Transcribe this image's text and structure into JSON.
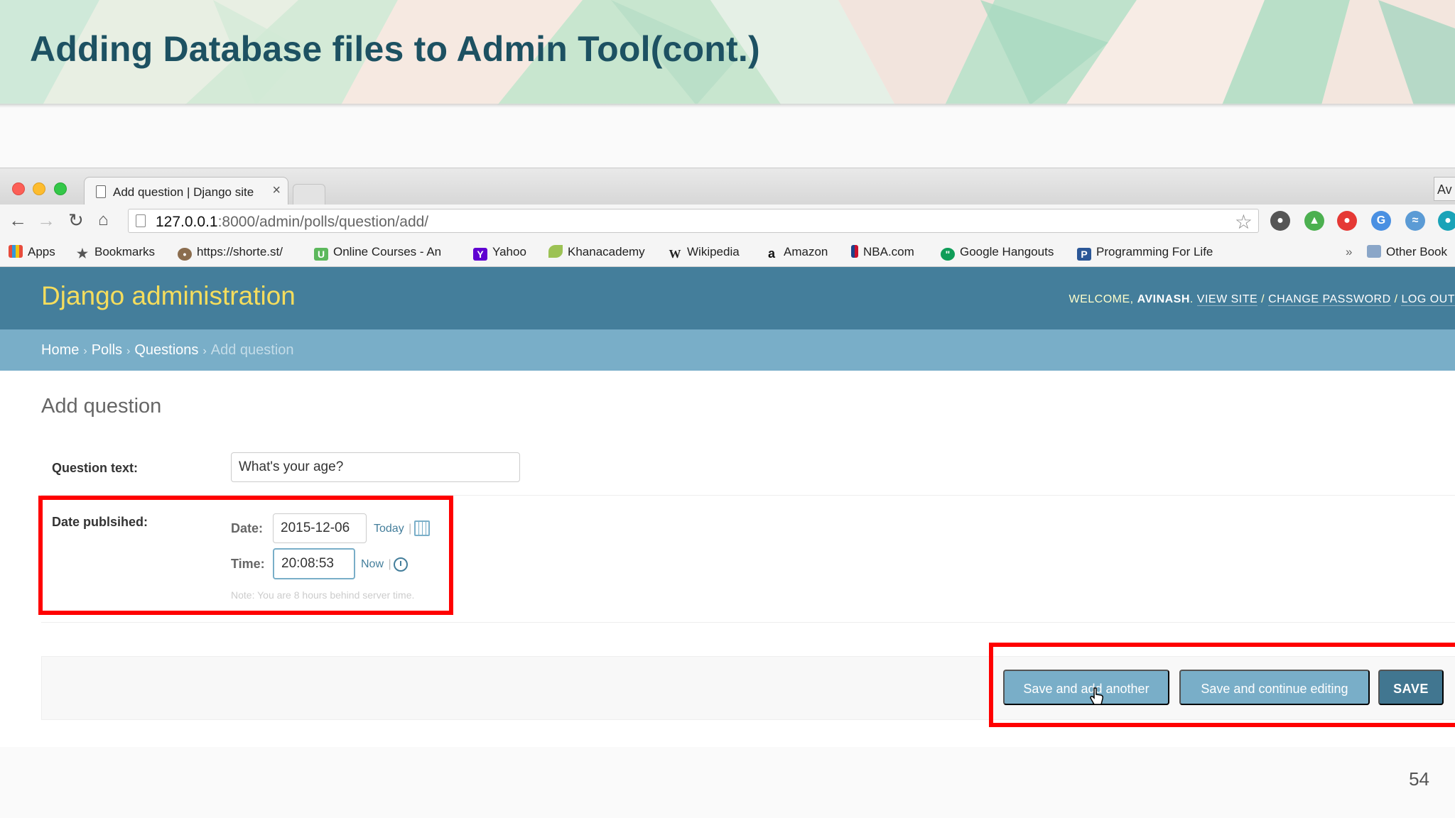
{
  "slide": {
    "title": "Adding Database files to Admin Tool(cont.)",
    "page_number": "54"
  },
  "browser": {
    "tab_title": "Add question | Django site",
    "tab_close": "×",
    "profile_label": "Av",
    "url_host": "127.0.0.1",
    "url_rest": ":8000/admin/polls/question/add/",
    "bookmarks": [
      {
        "label": "Apps",
        "icon": "apps-grid-icon"
      },
      {
        "label": "Bookmarks",
        "icon": "star-icon"
      },
      {
        "label": "https://shorte.st/",
        "icon": "shortest-icon"
      },
      {
        "label": "Online Courses - An",
        "icon": "udemy-icon"
      },
      {
        "label": "Yahoo",
        "icon": "yahoo-icon"
      },
      {
        "label": "Khanacademy",
        "icon": "leaf-icon"
      },
      {
        "label": "Wikipedia",
        "icon": "wikipedia-icon"
      },
      {
        "label": "Amazon",
        "icon": "amazon-icon"
      },
      {
        "label": "NBA.com",
        "icon": "nba-icon"
      },
      {
        "label": "Google Hangouts",
        "icon": "hangouts-icon"
      },
      {
        "label": "Programming For Life",
        "icon": "p-icon"
      }
    ],
    "bookmarks_overflow": "»",
    "other_bookmarks": "Other Book"
  },
  "admin": {
    "branding": "Django administration",
    "welcome": "WELCOME,",
    "username": "AVINASH",
    "view_site": "VIEW SITE",
    "change_password": "CHANGE PASSWORD",
    "log_out": "LOG OUT",
    "slash": "/",
    "breadcrumbs": {
      "home": "Home",
      "polls": "Polls",
      "questions": "Questions",
      "current": "Add question",
      "sep": "›"
    },
    "page_title": "Add question",
    "form": {
      "question_text_label": "Question text:",
      "question_text_value": "What's your age?",
      "date_published_label": "Date publsihed:",
      "date_label": "Date:",
      "date_value": "2015-12-06",
      "today_link": "Today",
      "time_label": "Time:",
      "time_value": "20:08:53",
      "now_link": "Now",
      "pipe": "|",
      "note": "Note: You are 8 hours behind server time."
    },
    "buttons": {
      "save_add_another": "Save and add another",
      "save_continue": "Save and continue editing",
      "save": "SAVE"
    }
  },
  "colors": {
    "header": "#447e9b",
    "breadcrumbs": "#79aec8",
    "branding": "#f5dd5d",
    "highlight": "#ff0000",
    "slide_title": "#1d5162"
  }
}
